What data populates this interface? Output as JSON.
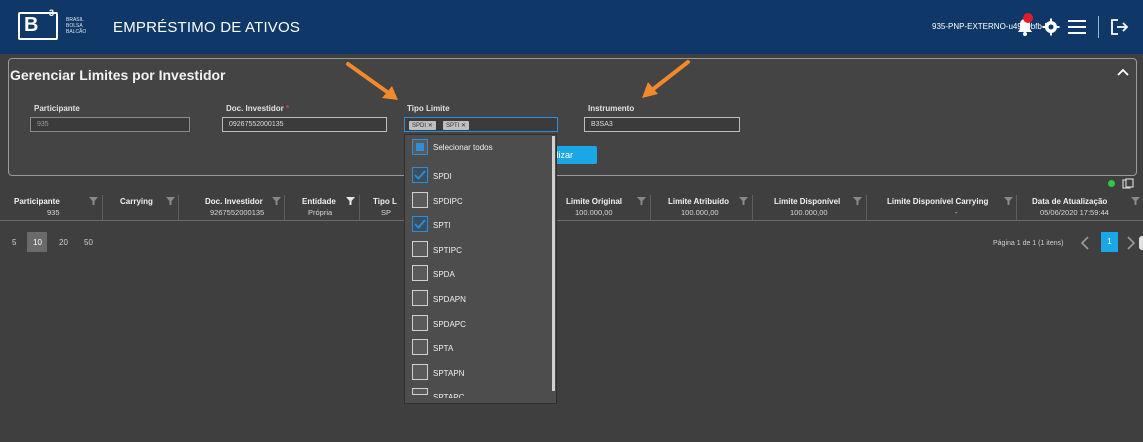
{
  "header": {
    "logo_letter": "B",
    "logo_sup": "3",
    "logo_text": "BRASIL BOLSA BALCÃO",
    "title": "EMPRÉSTIMO DE ATIVOS",
    "user_id": "935-PNP-EXTERNO-u4939bfb-51",
    "icons": [
      "bell-icon",
      "gear-icon",
      "menu-icon",
      "logout-icon"
    ]
  },
  "filters": {
    "title": "Gerenciar Limites por Investidor",
    "participante": {
      "label": "Participante",
      "value": "935"
    },
    "doc_investidor": {
      "label": "Doc. Investidor",
      "required_mark": "*",
      "value": "09267552000135"
    },
    "tipo_limite": {
      "label": "Tipo Limite",
      "chips": [
        "SPDI",
        "SPTI"
      ],
      "chip_remove": "✕"
    },
    "instrumento": {
      "label": "Instrumento",
      "value": "B3SA3"
    },
    "atualizar_label": "Atualizar",
    "atualizar_visible": "tualizar"
  },
  "table": {
    "headers": {
      "participante": "Participante",
      "carrying": "Carrying",
      "doc_investidor": "Doc. Investidor",
      "entidade": "Entidade",
      "tipo": "Tipo L",
      "limite_original": "Limite Original",
      "limite_atribuido": "Limite Atribuído",
      "limite_disponivel": "Limite Disponível",
      "limite_disponivel_carrying": "Limite Disponível Carrying",
      "data_atualizacao": "Data de Atualização"
    },
    "row": {
      "participante": "935",
      "carrying": "",
      "doc_investidor": "9267552000135",
      "entidade": "Própria",
      "tipo": "SP",
      "limite_original": "100.000,00",
      "limite_atribuido": "100.000,00",
      "limite_disponivel": "100.000,00",
      "limite_disponivel_carrying": "-",
      "data_atualizacao": "05/06/2020 17:59:44"
    }
  },
  "pager": {
    "sizes": [
      "5",
      "10",
      "20",
      "50"
    ],
    "active_size": "10",
    "info": "Página 1 de 1 (1 itens)",
    "current_page": "1"
  },
  "dropdown": {
    "select_all": "Selecionar todos",
    "options": [
      {
        "label": "SPDI",
        "checked": true
      },
      {
        "label": "SPDIPC",
        "checked": false
      },
      {
        "label": "SPTI",
        "checked": true
      },
      {
        "label": "SPTIPC",
        "checked": false
      },
      {
        "label": "SPDA",
        "checked": false
      },
      {
        "label": "SPDAPN",
        "checked": false
      },
      {
        "label": "SPDAPC",
        "checked": false
      },
      {
        "label": "SPTA",
        "checked": false
      },
      {
        "label": "SPTAPN",
        "checked": false
      },
      {
        "label": "SPTAPC",
        "checked": false
      }
    ]
  },
  "colors": {
    "header_bg": "#0f3868",
    "page_bg": "#3f3f3f",
    "accent": "#1aa7e6",
    "annotation_arrow": "#f08a2c",
    "badge": "#e01b2a"
  }
}
